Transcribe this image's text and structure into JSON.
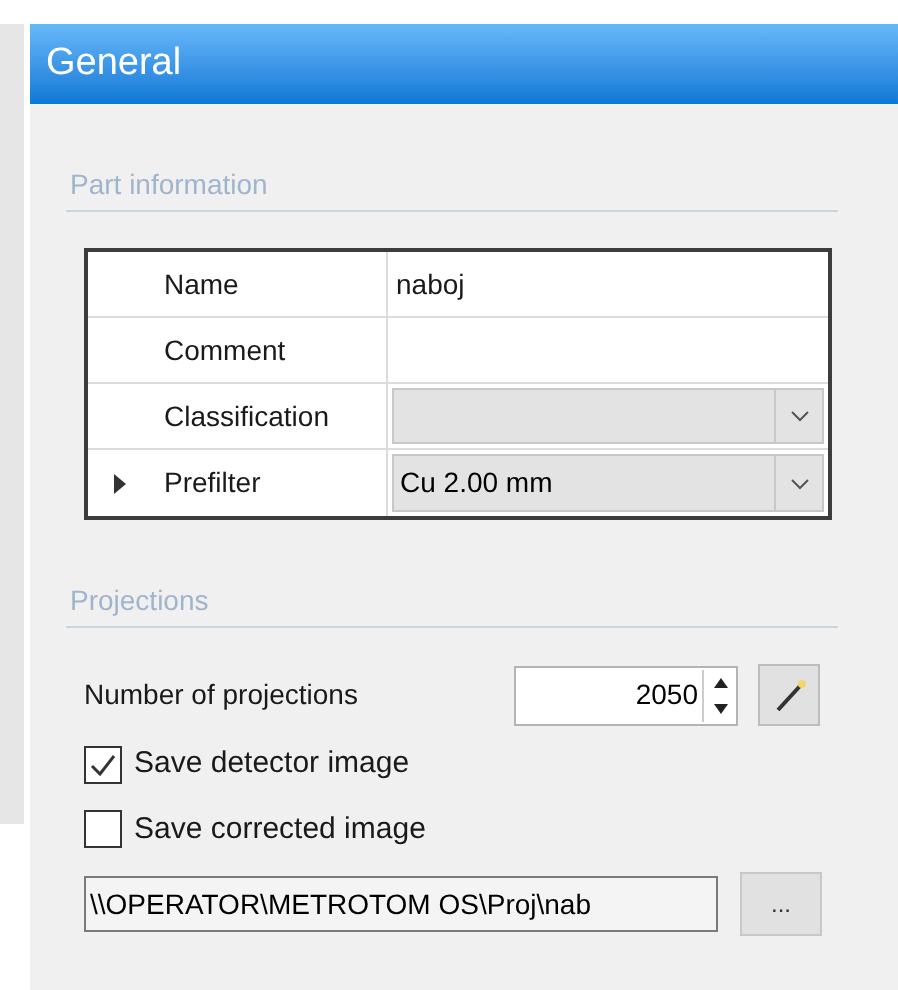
{
  "panel": {
    "title": "General"
  },
  "part_information": {
    "heading": "Part information",
    "rows": [
      {
        "label": "Name",
        "kind": "text",
        "value": "naboj",
        "current": false
      },
      {
        "label": "Comment",
        "kind": "text",
        "current": false
      },
      {
        "label": "Classification",
        "kind": "dropdown",
        "current": false
      },
      {
        "label": "Prefilter",
        "kind": "dropdown",
        "value": "Cu 2.00 mm",
        "current": true
      }
    ]
  },
  "projections": {
    "heading": "Projections",
    "count": {
      "label": "Number of projections",
      "value": "2050"
    },
    "checkboxes": [
      {
        "label": "Save detector image",
        "checked": true
      },
      {
        "label": "Save corrected image",
        "checked": false
      }
    ],
    "path": {
      "value": "\\\\OPERATOR\\METROTOM OS\\Proj\\nab",
      "browse": "..."
    }
  }
}
